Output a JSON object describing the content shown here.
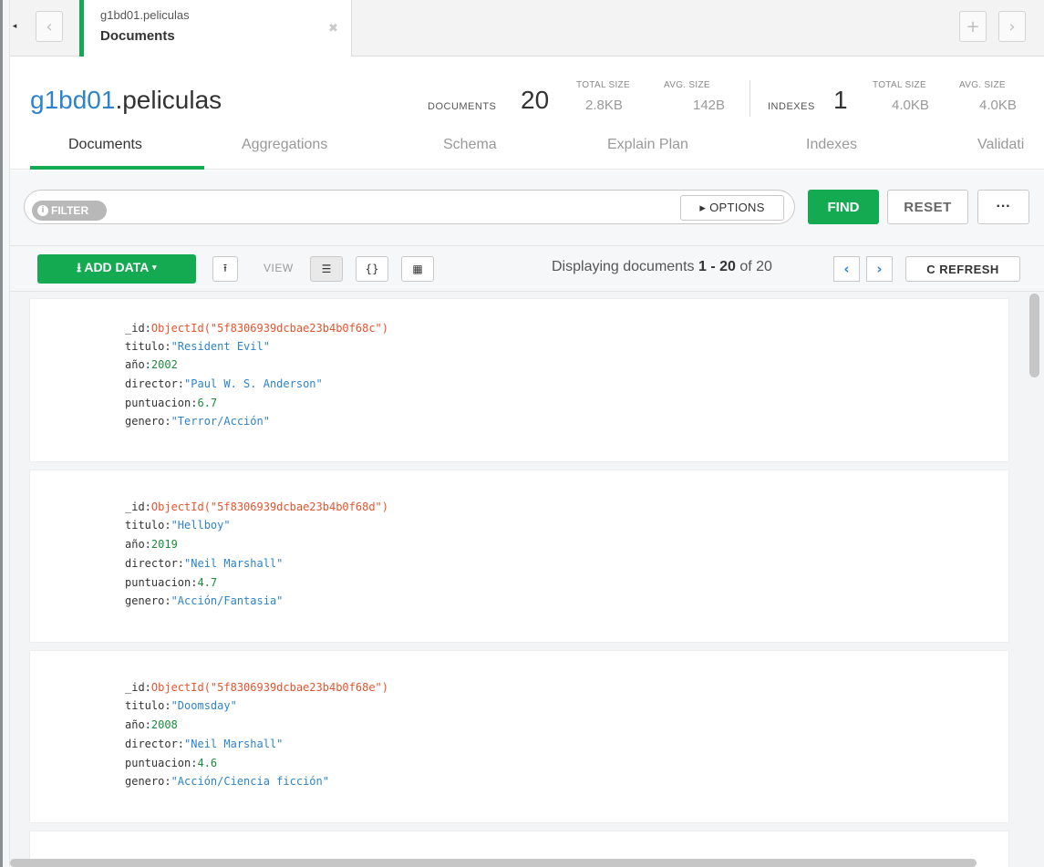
{
  "tab": {
    "namespace": "g1bd01.peliculas",
    "label": "Documents",
    "close_glyph": "✖"
  },
  "tabstrip": {
    "prev_glyph": "‹",
    "next_glyph": "›",
    "new_tab_glyph": "+",
    "collapse_glyph": "◂"
  },
  "header": {
    "db": "g1bd01",
    "collection": ".peliculas",
    "documents_label": "DOCUMENTS",
    "documents_count": "20",
    "doc_total_size_label": "TOTAL SIZE",
    "doc_total_size": "2.8KB",
    "doc_avg_size_label": "AVG. SIZE",
    "doc_avg_size": "142B",
    "indexes_label": "INDEXES",
    "indexes_count": "1",
    "idx_total_size_label": "TOTAL SIZE",
    "idx_total_size": "4.0KB",
    "idx_avg_size_label": "AVG. SIZE",
    "idx_avg_size": "4.0KB"
  },
  "subtabs": [
    {
      "label": "Documents",
      "active": true
    },
    {
      "label": "Aggregations"
    },
    {
      "label": "Schema"
    },
    {
      "label": "Explain Plan"
    },
    {
      "label": "Indexes"
    },
    {
      "label": "Validati"
    }
  ],
  "query": {
    "filter_label": "FILTER",
    "options_label": "▸ OPTIONS",
    "find_label": "FIND",
    "reset_label": "RESET",
    "more_label": "···"
  },
  "controls": {
    "add_data_label": "⭳ ADD DATA ▾",
    "view_label": "VIEW",
    "display_prefix": "Displaying documents ",
    "display_range": "1 - 20",
    "display_of": " of 20",
    "refresh_label": "C REFRESH"
  },
  "documents": [
    {
      "id": "ObjectId(\"5f8306939dcbae23b4b0f68c\")",
      "titulo": "\"Resident Evil\"",
      "anio": "2002",
      "director": "\"Paul W. S. Anderson\"",
      "puntuacion": "6.7",
      "genero": "\"Terror/Acción\""
    },
    {
      "id": "ObjectId(\"5f8306939dcbae23b4b0f68d\")",
      "titulo": "\"Hellboy\"",
      "anio": "2019",
      "director": "\"Neil Marshall\"",
      "puntuacion": "4.7",
      "genero": "\"Acción/Fantasia\""
    },
    {
      "id": "ObjectId(\"5f8306939dcbae23b4b0f68e\")",
      "titulo": "\"Doomsday\"",
      "anio": "2008",
      "director": "\"Neil Marshall\"",
      "puntuacion": "4.6",
      "genero": "\"Acción/Ciencia ficción\""
    }
  ],
  "field_keys": {
    "id": "_id:",
    "titulo": "titulo:",
    "anio": "año:",
    "director": "director:",
    "puntuacion": "puntuacion:",
    "genero": "genero:"
  },
  "colors": {
    "accent_green": "#13aa52",
    "string_blue": "#2f83c9",
    "number_green": "#1d8a3e",
    "objectid_orange": "#e4542f"
  }
}
